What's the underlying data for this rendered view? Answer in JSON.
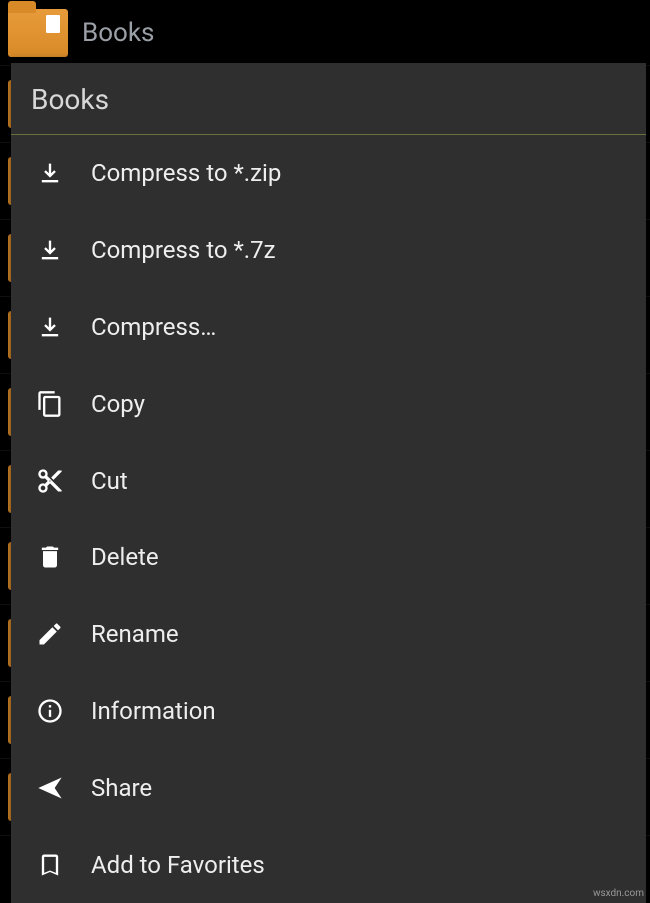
{
  "header": {
    "folder_name": "Books"
  },
  "menu": {
    "title": "Books",
    "items": [
      {
        "icon": "download",
        "label": "Compress to *.zip"
      },
      {
        "icon": "download",
        "label": "Compress to *.7z"
      },
      {
        "icon": "download",
        "label": "Compress…"
      },
      {
        "icon": "copy",
        "label": "Copy"
      },
      {
        "icon": "cut",
        "label": "Cut"
      },
      {
        "icon": "delete",
        "label": "Delete"
      },
      {
        "icon": "rename",
        "label": "Rename"
      },
      {
        "icon": "info",
        "label": "Information"
      },
      {
        "icon": "share",
        "label": "Share"
      },
      {
        "icon": "favorite",
        "label": "Add to Favorites"
      }
    ]
  },
  "watermark": "wsxdn.com"
}
